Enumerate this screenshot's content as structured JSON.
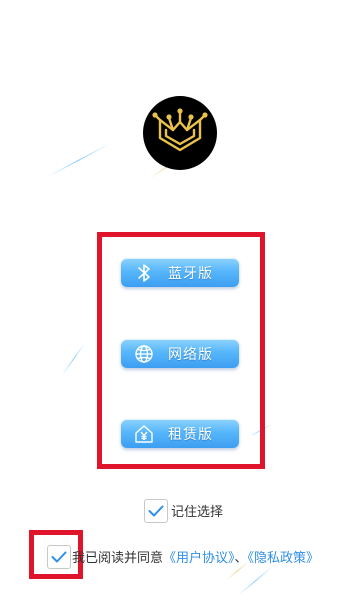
{
  "colors": {
    "accent": "#3d9ef2",
    "link": "#2f8fe6",
    "highlight": "#e0142a",
    "logo_gold": "#e8c24a"
  },
  "logo": {
    "icon": "circuit-m-logo-icon"
  },
  "modes": [
    {
      "label": "蓝牙版",
      "icon": "bluetooth-icon"
    },
    {
      "label": "网络版",
      "icon": "globe-icon"
    },
    {
      "label": "租赁版",
      "icon": "yen-house-icon"
    }
  ],
  "remember": {
    "label": "记住选择",
    "checked": true
  },
  "agreement": {
    "checked": true,
    "prefix": "我已阅读并同意",
    "user_agreement": "《用户协议》",
    "separator": "、",
    "privacy_policy": "《隐私政策》"
  }
}
